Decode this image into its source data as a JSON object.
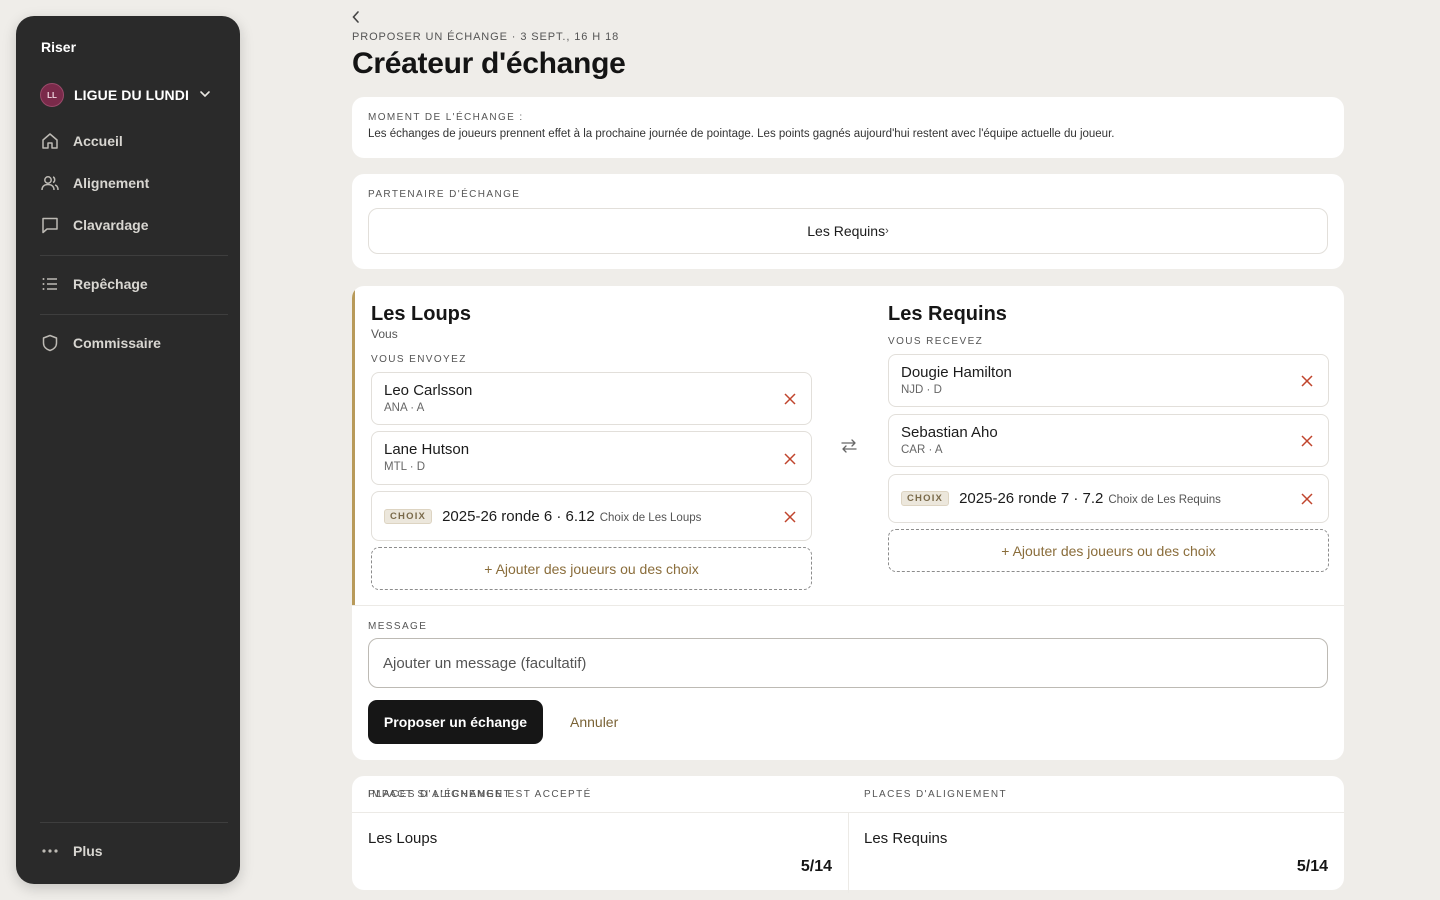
{
  "sidebar": {
    "brand": "Riser",
    "league": {
      "initials": "LL",
      "name": "LIGUE DU LUNDI"
    },
    "items": [
      {
        "label": "Accueil",
        "icon": "home-icon"
      },
      {
        "label": "Alignement",
        "icon": "users-icon"
      },
      {
        "label": "Clavardage",
        "icon": "chat-icon"
      },
      {
        "label": "Repêchage",
        "icon": "list-icon"
      },
      {
        "label": "Commissaire",
        "icon": "shield-icon"
      }
    ],
    "more": {
      "label": "Plus",
      "icon": "more-icon"
    }
  },
  "header": {
    "breadcrumb": "PROPOSER UN ÉCHANGE · 3 SEPT., 16 H 18",
    "title": "Créateur d'échange"
  },
  "timing": {
    "label": "MOMENT DE L'ÉCHANGE :",
    "text": "Les échanges de joueurs prennent effet à la prochaine journée de pointage. Les points gagnés aujourd'hui restent avec l'équipe actuelle du joueur."
  },
  "partner": {
    "label": "PARTENAIRE D'ÉCHANGE",
    "value": "Les Requins",
    "chevron": "›"
  },
  "trade": {
    "left": {
      "team": "Les Loups",
      "sub": "Vous",
      "direction": "VOUS ENVOYEZ",
      "players": [
        {
          "name": "Leo Carlsson",
          "meta": "ANA · A"
        },
        {
          "name": "Lane Hutson",
          "meta": "MTL · D"
        }
      ],
      "pick": {
        "badge": "CHOIX",
        "main": "2025-26 ronde 6 · 6.12",
        "sub": "Choix de Les Loups"
      },
      "add_label": "+ Ajouter des joueurs ou des choix"
    },
    "right": {
      "team": "Les Requins",
      "direction": "VOUS RECEVEZ",
      "players": [
        {
          "name": "Dougie Hamilton",
          "meta": "NJD · D"
        },
        {
          "name": "Sebastian Aho",
          "meta": "CAR · A"
        }
      ],
      "pick": {
        "badge": "CHOIX",
        "main": "2025-26 ronde 7 · 7.2",
        "sub": "Choix de Les Requins"
      },
      "add_label": "+ Ajouter des joueurs ou des choix"
    },
    "message": {
      "label": "MESSAGE",
      "placeholder": "Ajouter un message (facultatif)"
    },
    "submit_label": "Proposer un échange",
    "cancel_label": "Annuler"
  },
  "impact": {
    "label": "IMPACT SI L'ÉCHANGE EST ACCEPTÉ",
    "teams": [
      {
        "name": "Les Loups",
        "stat_label": "PLACES D'ALIGNEMENT",
        "stat_value": "5/14"
      },
      {
        "name": "Les Requins",
        "stat_label": "PLACES D'ALIGNEMENT",
        "stat_value": "5/14"
      }
    ]
  },
  "colors": {
    "accent": "#b89a5a",
    "remove": "#c0452d",
    "link": "#8a6d3b",
    "sidebar": "#2a2a2a"
  }
}
